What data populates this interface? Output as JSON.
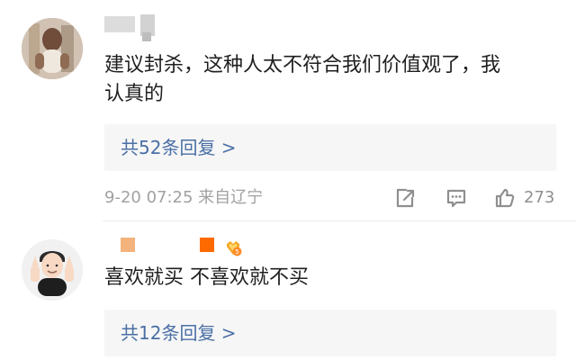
{
  "comments": [
    {
      "content_line1": "建议封杀，这种人太不符合我们价值观了，我",
      "content_line2": "认真的",
      "reply_label": "共52条回复 >",
      "timestamp": "9-20 07:25 来自辽宁",
      "likes": "273"
    },
    {
      "content": "喜欢就买 不喜欢就不买",
      "reply_label": "共12条回复 >"
    }
  ],
  "colors": {
    "reply_blue": "#4a6fa5",
    "meta_gray": "#a1a1a1"
  },
  "icons": {
    "share": "share-icon",
    "comment": "comment-icon",
    "like": "thumbs-up-icon",
    "vip": "vip-badge-icon"
  }
}
